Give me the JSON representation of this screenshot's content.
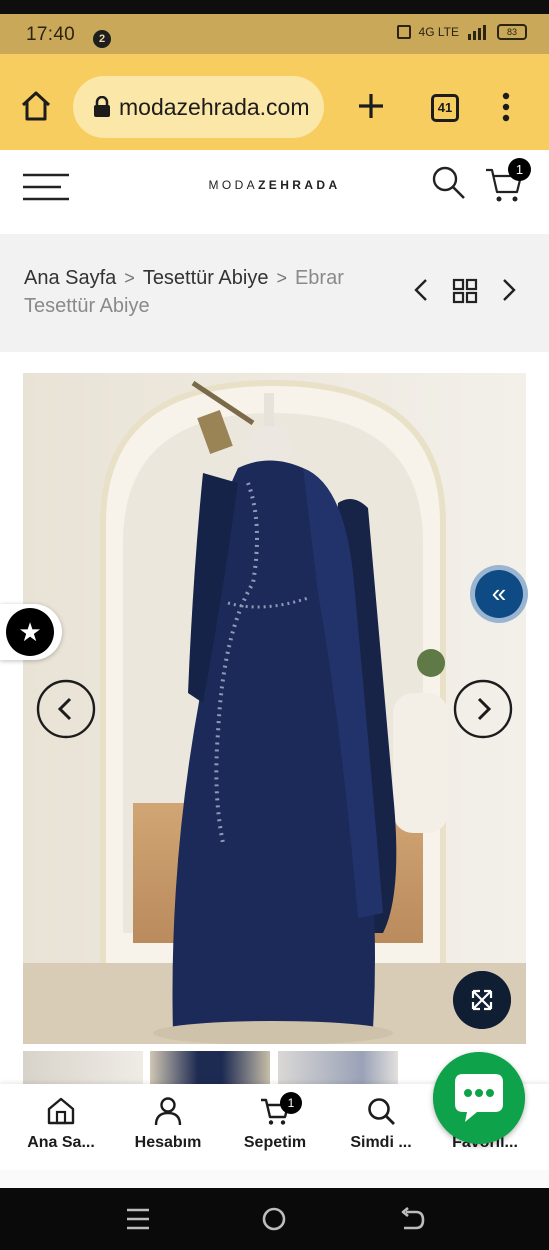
{
  "status_bar": {
    "time": "17:40",
    "notification_count": "2",
    "network": "4G LTE",
    "battery": "83"
  },
  "browser": {
    "url": "modazehrada.com",
    "tab_count": "41"
  },
  "site": {
    "logo_light": "MODA",
    "logo_bold": "ZEHRADA",
    "cart_count": "1"
  },
  "breadcrumb": {
    "items": [
      "Ana Sayfa",
      "Tesettür Abiye",
      "Ebrar Tesettür Abiye"
    ]
  },
  "bottom_nav": {
    "items": [
      {
        "label": "Ana Sa...",
        "icon": "home-icon"
      },
      {
        "label": "Hesabım",
        "icon": "user-icon"
      },
      {
        "label": "Sepetim",
        "icon": "cart-icon"
      },
      {
        "label": "Simdi ...",
        "icon": "search-icon"
      },
      {
        "label": "Favoril...",
        "icon": "heart-icon"
      }
    ],
    "cart_badge": "1"
  },
  "colors": {
    "browser_bar": "#f7cd60",
    "dress_navy": "#1b2a58",
    "chat_green": "#0ea34a",
    "collapse_blue": "#0e4a83"
  }
}
